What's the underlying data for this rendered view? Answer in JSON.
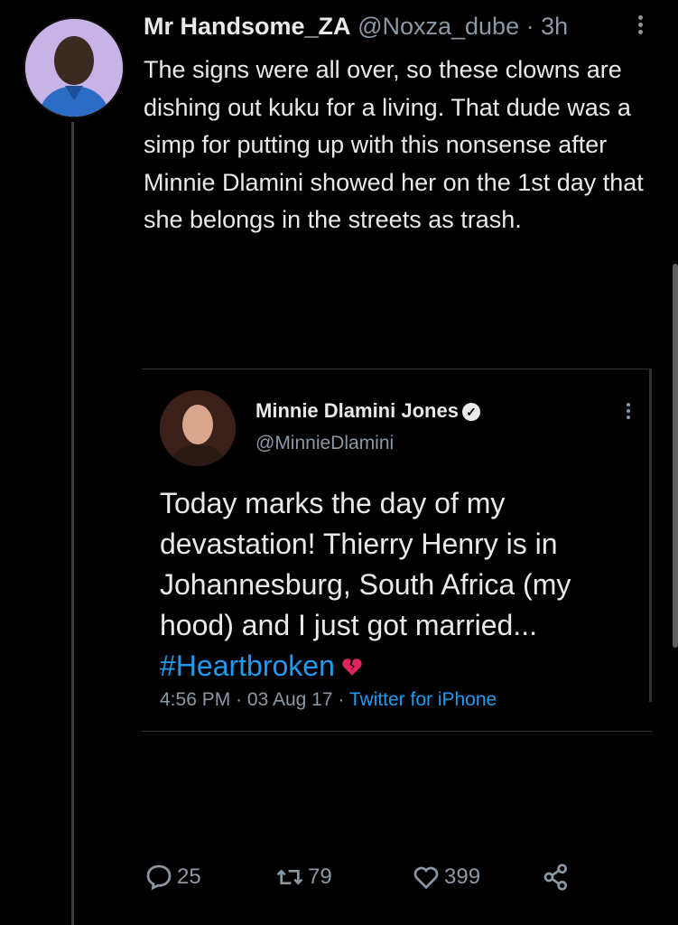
{
  "tweet": {
    "display_name": "Mr Handsome_ZA",
    "handle": "@Noxza_dube",
    "separator": "·",
    "time": "3h",
    "text": "The signs were all over, so these clowns are dishing out kuku for a living. That dude was a simp for putting up with this nonsense after Minnie Dlamini showed her on the 1st day that she belongs in the streets as trash."
  },
  "quoted_tweet": {
    "display_name": "Minnie Dlamini Jones",
    "handle": "@MinnieDlamini",
    "text": "Today marks the day of my devastation! Thierry Henry is in Johannesburg, South Africa (my hood) and I just got married...",
    "hashtag": "#Heartbroken",
    "time": "4:56 PM",
    "date": "03 Aug 17",
    "source": "Twitter for iPhone",
    "separator": "·"
  },
  "actions": {
    "replies": "25",
    "retweets": "79",
    "likes": "399"
  },
  "icons": [
    "more-icon",
    "verified-icon",
    "broken-heart-icon",
    "reply-icon",
    "retweet-icon",
    "like-icon",
    "share-icon"
  ],
  "colors": {
    "background": "#000000",
    "link": "#1d9bf0",
    "muted": "#8b98a5",
    "text": "#e7e9ea"
  }
}
